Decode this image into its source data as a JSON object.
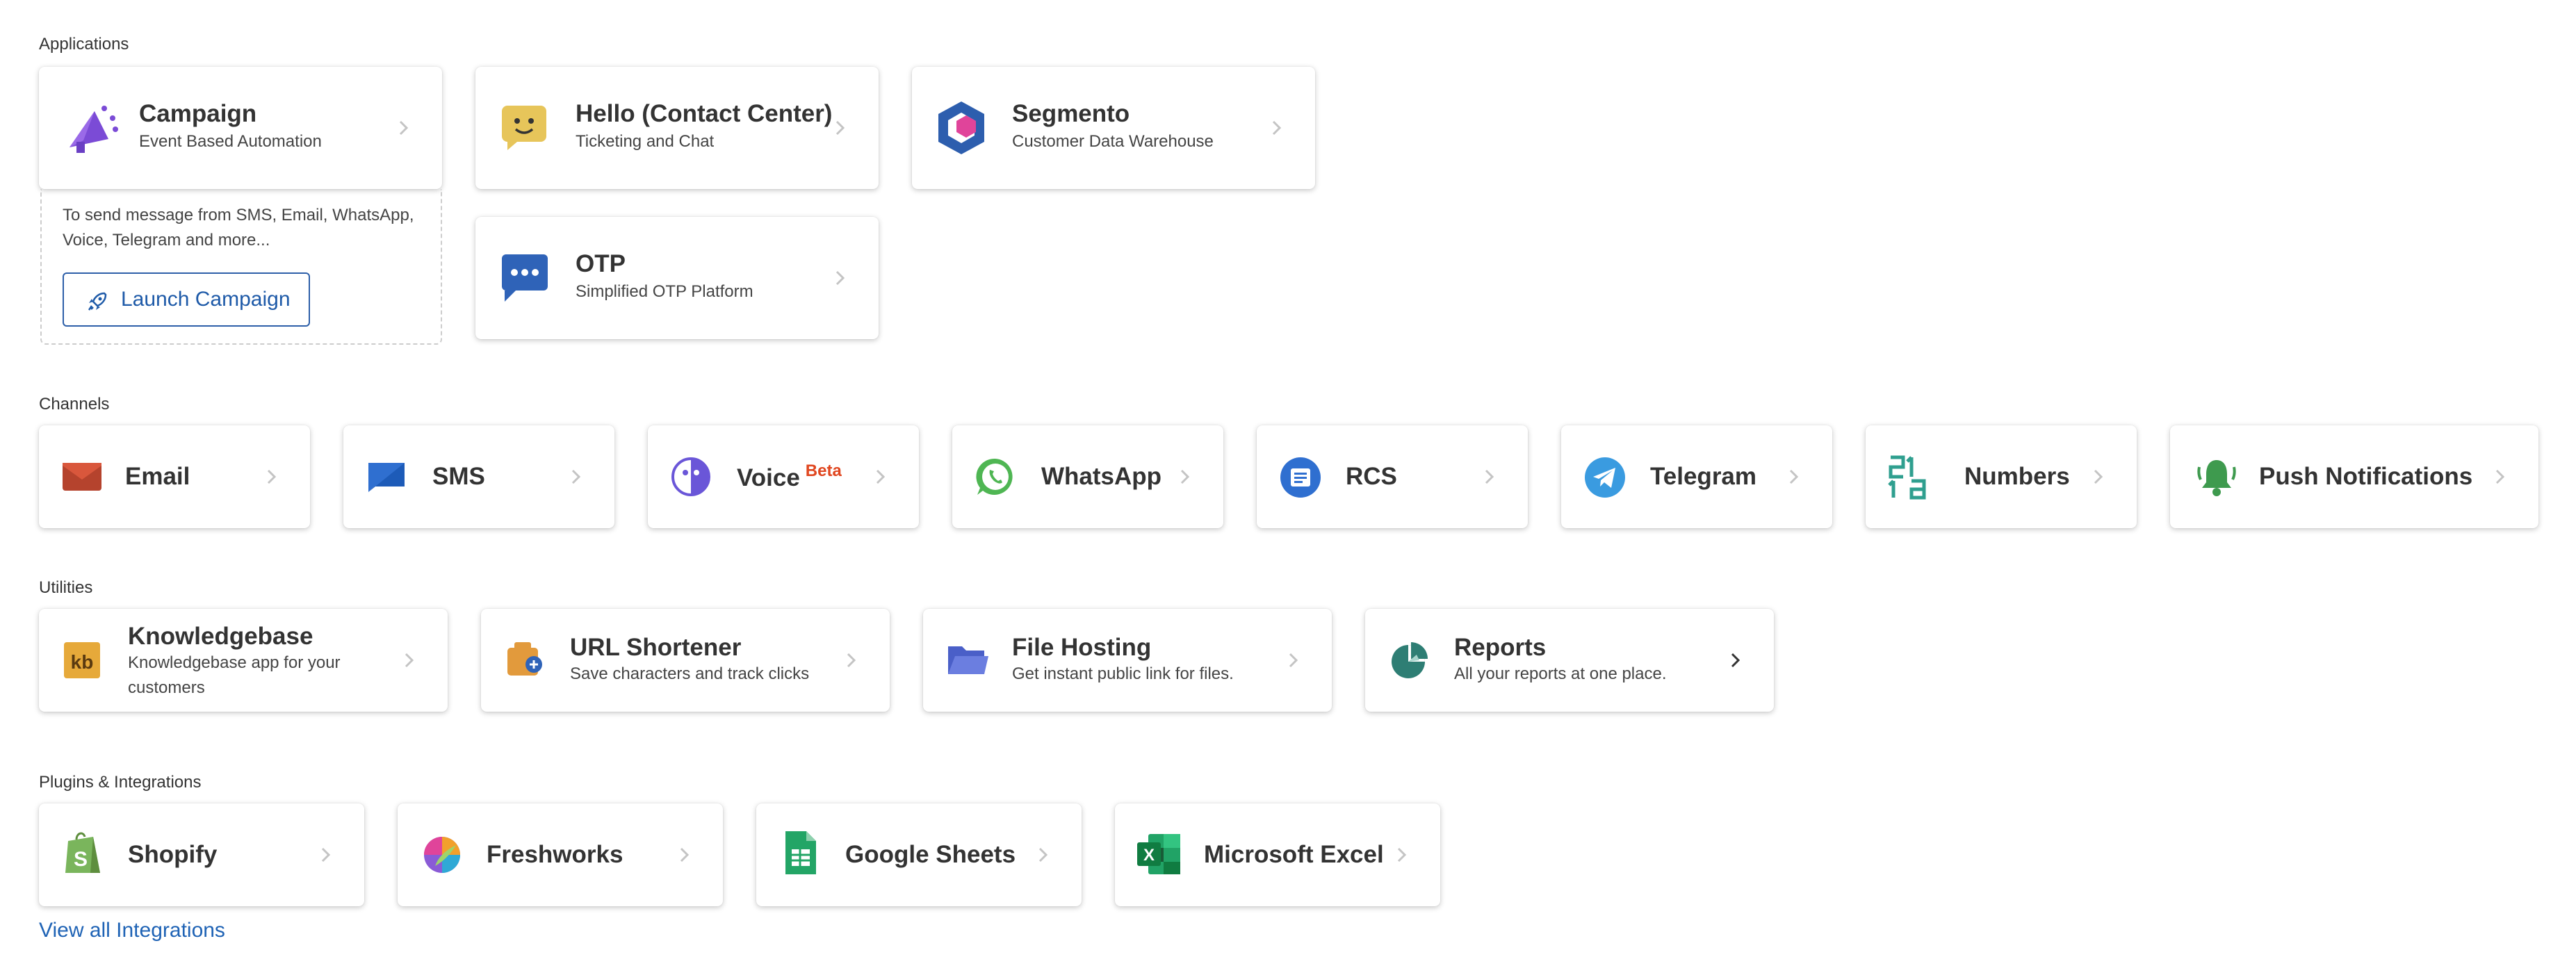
{
  "sections": {
    "applications": "Applications",
    "channels": "Channels",
    "utilities": "Utilities",
    "plugins": "Plugins & Integrations"
  },
  "apps": {
    "campaign": {
      "title": "Campaign",
      "subtitle": "Event Based Automation",
      "icon": "megaphone-icon"
    },
    "hello": {
      "title": "Hello (Contact Center)",
      "subtitle": "Ticketing and Chat",
      "icon": "chat-smiley-icon"
    },
    "segmento": {
      "title": "Segmento",
      "subtitle": "Customer Data Warehouse",
      "icon": "hexagon-icon"
    },
    "otp": {
      "title": "OTP",
      "subtitle": "Simplified OTP Platform",
      "icon": "message-dots-icon"
    }
  },
  "campaign_hint": "To send message from SMS, Email, WhatsApp, Voice, Telegram and more...",
  "launch_button": "Launch Campaign",
  "channels": {
    "email": "Email",
    "sms": "SMS",
    "voice": "Voice",
    "voice_badge": "Beta",
    "whatsapp": "WhatsApp",
    "rcs": "RCS",
    "telegram": "Telegram",
    "numbers": "Numbers",
    "push": "Push Notifications"
  },
  "utilities": {
    "knowledgebase": {
      "title": "Knowledgebase",
      "subtitle": "Knowledgebase app for your customers"
    },
    "url": {
      "title": "URL Shortener",
      "subtitle": "Save characters and track clicks"
    },
    "file": {
      "title": "File Hosting",
      "subtitle": "Get instant public link for files."
    },
    "reports": {
      "title": "Reports",
      "subtitle": "All your reports at one place."
    }
  },
  "plugins": {
    "shopify": "Shopify",
    "freshworks": "Freshworks",
    "gsheets": "Google Sheets",
    "excel": "Microsoft Excel"
  },
  "view_all": "View all Integrations",
  "colors": {
    "accent_link": "#1f63b5",
    "beta_badge": "#e0461f",
    "chevron_default": "#c4c4c4",
    "chevron_active": "#333333"
  }
}
